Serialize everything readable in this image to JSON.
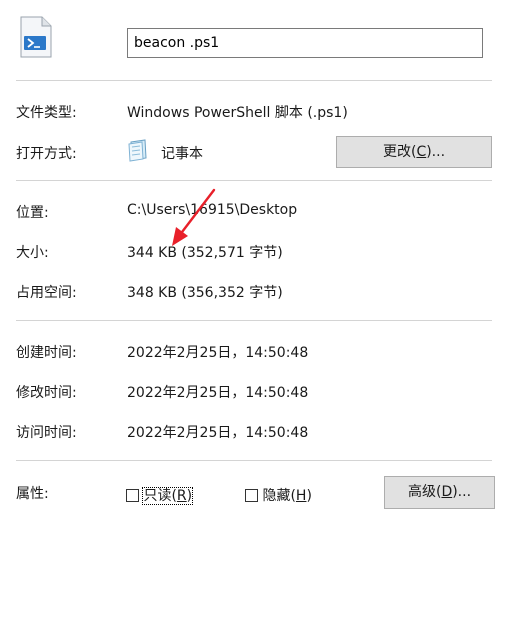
{
  "file": {
    "name": "beacon .ps1",
    "icon": "powershell-script-icon"
  },
  "details": {
    "type_label": "文件类型:",
    "type_value": "Windows PowerShell 脚本 (.ps1)",
    "opens_with_label": "打开方式:",
    "opens_with_app": "记事本",
    "opens_with_icon": "notepad-icon",
    "change_button": {
      "text": "更改(",
      "hotkey": "C",
      "suffix": ")..."
    },
    "location_label": "位置:",
    "location_value": "C:\\Users\\16915\\Desktop",
    "size_label": "大小:",
    "size_value": "344 KB (352,571 字节)",
    "size_on_disk_label": "占用空间:",
    "size_on_disk_value": "348 KB (356,352 字节)",
    "created_label": "创建时间:",
    "created_value": "2022年2月25日，14:50:48",
    "modified_label": "修改时间:",
    "modified_value": "2022年2月25日，14:50:48",
    "accessed_label": "访问时间:",
    "accessed_value": "2022年2月25日，14:50:48"
  },
  "attributes": {
    "label": "属性:",
    "readonly": {
      "text": "只读(",
      "hotkey": "R",
      "suffix": ")",
      "checked": false
    },
    "hidden": {
      "text": "隐藏(",
      "hotkey": "H",
      "suffix": ")",
      "checked": false
    },
    "advanced_button": {
      "text": "高级(",
      "hotkey": "D",
      "suffix": ")..."
    }
  },
  "annotation": {
    "color": "#e8202a"
  }
}
